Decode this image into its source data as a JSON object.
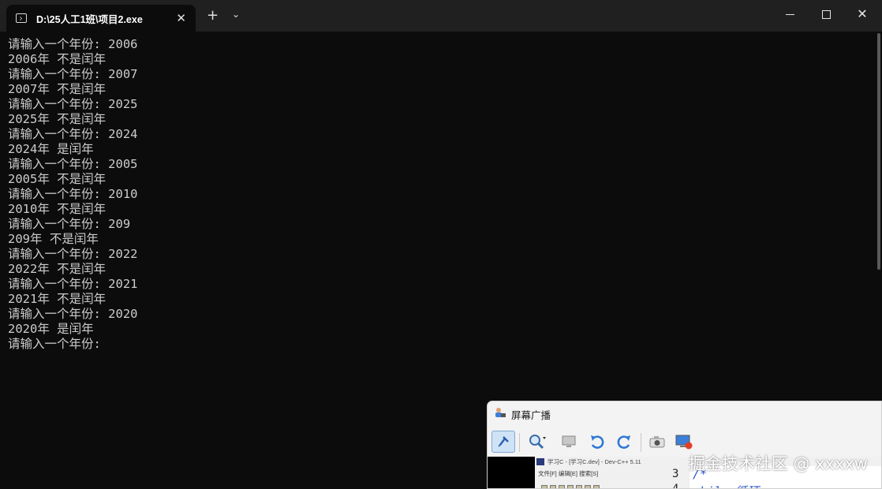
{
  "window": {
    "tab_title": "D:\\25人工1班\\项目2.exe",
    "tab_close": "✕",
    "new_tab": "+",
    "dropdown": "⌄",
    "close_glyph": "✕"
  },
  "console": {
    "lines": [
      "请输入一个年份: 2006",
      "2006年 不是闰年",
      "请输入一个年份: 2007",
      "2007年 不是闰年",
      "请输入一个年份: 2025",
      "2025年 不是闰年",
      "请输入一个年份: 2024",
      "2024年 是闰年",
      "请输入一个年份: 2005",
      "2005年 不是闰年",
      "请输入一个年份: 2010",
      "2010年 不是闰年",
      "请输入一个年份: 209",
      "209年 不是闰年",
      "请输入一个年份: 2022",
      "2022年 不是闰年",
      "请输入一个年份: 2021",
      "2021年 不是闰年",
      "请输入一个年份: 2020",
      "2020年 是闰年",
      "请输入一个年份:"
    ]
  },
  "broadcast": {
    "title": "屏幕广播",
    "preview_title": "学习C - [学习C.dev] - Dev-C++ 5.11",
    "preview_menu": "文件[F]   编辑[E]   搜索[S]",
    "line_numbers": [
      "3",
      "4"
    ],
    "code_lines": [
      "/*",
      "while 循环"
    ],
    "watermark": "掘金技术社区 @ xxxxw"
  },
  "colors": {
    "console_bg": "#0c0c0c",
    "console_text": "#cccccc",
    "titlebar_bg": "#202020",
    "accent": "#3b7fd9"
  }
}
